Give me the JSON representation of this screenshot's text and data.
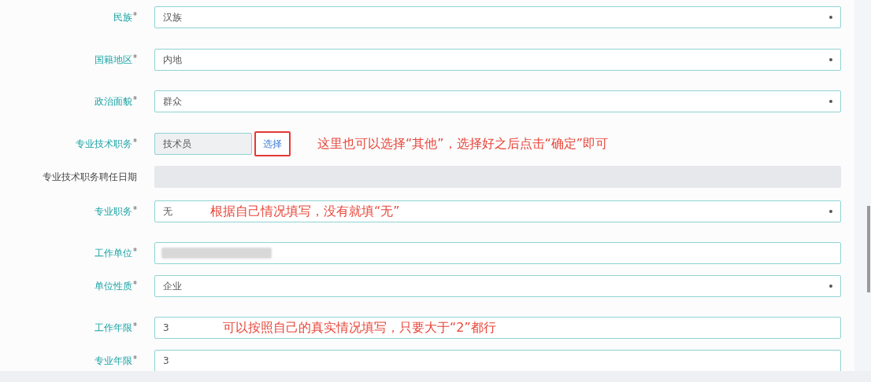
{
  "fields": [
    {
      "label": "民族",
      "required": true,
      "kind": "select",
      "value": "汉族"
    },
    {
      "label": "国籍地区",
      "required": true,
      "kind": "select",
      "value": "内地"
    },
    {
      "label": "政治面貌",
      "required": true,
      "kind": "select",
      "value": "群众"
    },
    {
      "label": "专业技术职务",
      "required": true,
      "kind": "picker",
      "value": "技术员",
      "button": "选择",
      "note": "这里也可以选择“其他”，选择好之后点击“确定”即可"
    },
    {
      "label": "专业技术职务聘任日期",
      "required": false,
      "kind": "disabled"
    },
    {
      "label": "专业职务",
      "required": true,
      "kind": "select",
      "value": "无",
      "note": "根据自己情况填写，没有就填“无”"
    },
    {
      "label": "工作单位",
      "required": true,
      "kind": "blurred"
    },
    {
      "label": "单位性质",
      "required": true,
      "kind": "select",
      "value": "企业"
    },
    {
      "label": "工作年限",
      "required": true,
      "kind": "text",
      "value": "3",
      "note": "可以按照自己的真实情况填写，只要大于“2”都行"
    },
    {
      "label": "专业年限",
      "required": true,
      "kind": "text",
      "value": "3"
    }
  ]
}
